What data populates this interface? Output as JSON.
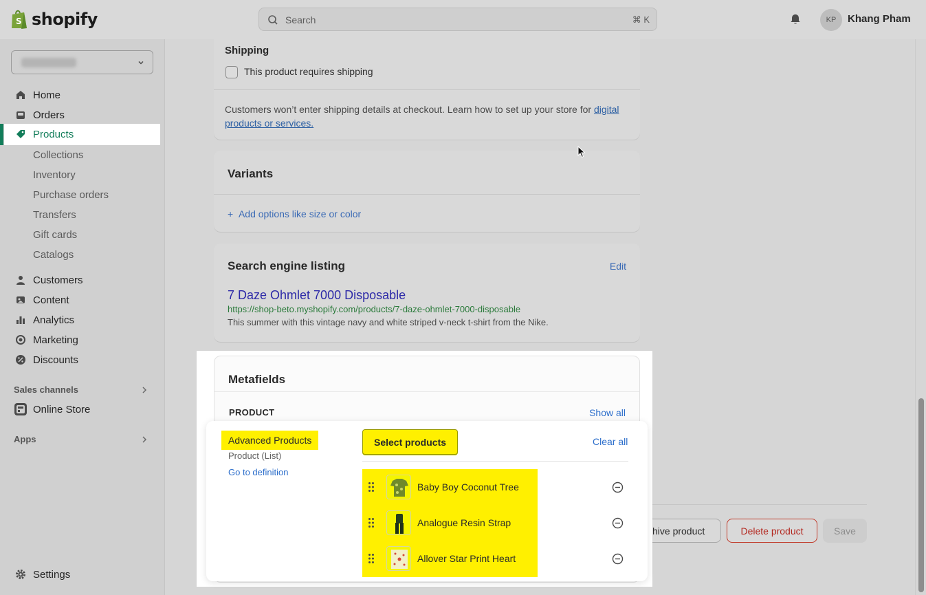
{
  "topbar": {
    "logo_text": "shopify",
    "search_placeholder": "Search",
    "search_shortcut": "⌘ K",
    "avatar_initials": "KP",
    "user_name": "Khang Pham"
  },
  "sidebar": {
    "items": [
      {
        "label": "Home",
        "icon": "home-icon"
      },
      {
        "label": "Orders",
        "icon": "orders-icon"
      },
      {
        "label": "Products",
        "icon": "tag-icon",
        "active": true
      },
      {
        "label": "Collections"
      },
      {
        "label": "Inventory"
      },
      {
        "label": "Purchase orders"
      },
      {
        "label": "Transfers"
      },
      {
        "label": "Gift cards"
      },
      {
        "label": "Catalogs"
      },
      {
        "label": "Customers",
        "icon": "person-icon"
      },
      {
        "label": "Content",
        "icon": "content-icon"
      },
      {
        "label": "Analytics",
        "icon": "bar-chart-icon"
      },
      {
        "label": "Marketing",
        "icon": "target-icon"
      },
      {
        "label": "Discounts",
        "icon": "discount-icon"
      }
    ],
    "sales_channels_label": "Sales channels",
    "online_store_label": "Online Store",
    "apps_label": "Apps",
    "settings_label": "Settings",
    "accent_color": "#127d5a"
  },
  "shipping": {
    "title": "Shipping",
    "checkbox_label": "This product requires shipping",
    "note": "Customers won’t enter shipping details at checkout. Learn how to set up your store for ",
    "note_link": "digital products or services."
  },
  "variants": {
    "title": "Variants",
    "add_label": "Add options like size or color"
  },
  "seo": {
    "title": "Search engine listing",
    "edit_label": "Edit",
    "page_title": "7 Daze Ohmlet 7000 Disposable",
    "url": "https://shop-beto.myshopify.com/products/7-daze-ohmlet-7000-disposable",
    "description": "This summer with this vintage navy and white striped v-neck t-shirt from the Nike."
  },
  "metafields": {
    "title": "Metafields",
    "section_label": "PRODUCT",
    "show_all_label": "Show all",
    "field_name": "Advanced Products",
    "field_type": "Product (List)",
    "go_to_definition": "Go to definition",
    "select_button": "Select products",
    "clear_all": "Clear all",
    "products": [
      {
        "name": "Baby Boy Coconut Tree"
      },
      {
        "name": "Analogue Resin Strap"
      },
      {
        "name": "Allover Star Print Heart"
      }
    ],
    "highlight_color": "#fff000"
  },
  "actions": {
    "archive_label": "chive product",
    "delete_label": "Delete product",
    "save_label": "Save"
  }
}
